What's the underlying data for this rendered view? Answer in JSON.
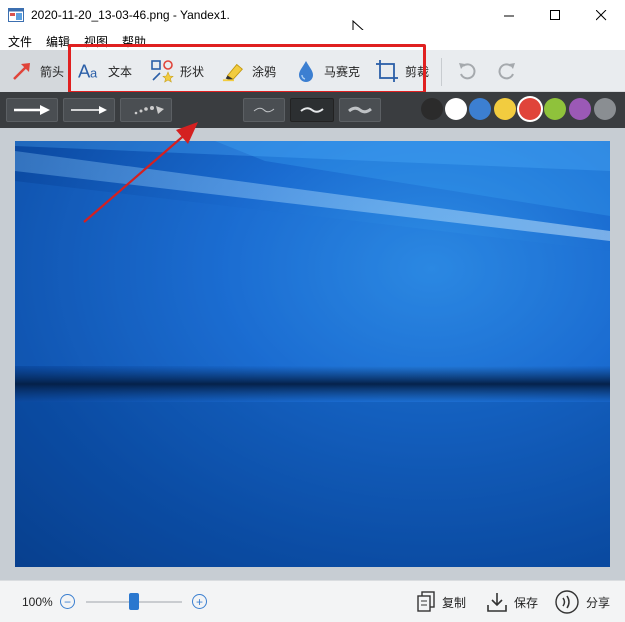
{
  "window": {
    "title": "2020-11-20_13-03-46.png - Yandex1."
  },
  "menu": {
    "items": [
      "文件",
      "编辑",
      "视图",
      "帮助"
    ]
  },
  "toolbar": {
    "tools": [
      {
        "label": "箭头",
        "icon": "arrow-icon"
      },
      {
        "label": "文本",
        "icon": "text-icon"
      },
      {
        "label": "形状",
        "icon": "shapes-icon"
      },
      {
        "label": "涂鸦",
        "icon": "highlighter-icon"
      },
      {
        "label": "马赛克",
        "icon": "blur-drop-icon"
      },
      {
        "label": "剪裁",
        "icon": "crop-icon"
      }
    ],
    "undo_icon": "undo-icon",
    "redo_icon": "redo-icon",
    "active_tool": "箭头"
  },
  "subbar": {
    "arrow_styles": [
      "arrow-thick",
      "arrow-thin",
      "arrow-dotted"
    ],
    "line_styles": [
      "wave-thin",
      "wave-medium",
      "wave-thick"
    ],
    "active_line_style": "wave-medium",
    "colors": [
      "#2b2b2b",
      "#ffffff",
      "#3c7fd1",
      "#f2cc3f",
      "#e0443a",
      "#8fc23b",
      "#9b59b6",
      "#8a8e92"
    ],
    "selected_color": "#e0443a"
  },
  "statusbar": {
    "zoom": "100%",
    "zoom_level": 0.5,
    "copy_label": "复制",
    "save_label": "保存",
    "share_label": "分享"
  },
  "colors": {
    "highlight_box": "#e02020",
    "annotation_arrow": "#d42020",
    "accent": "#2b78cf"
  }
}
